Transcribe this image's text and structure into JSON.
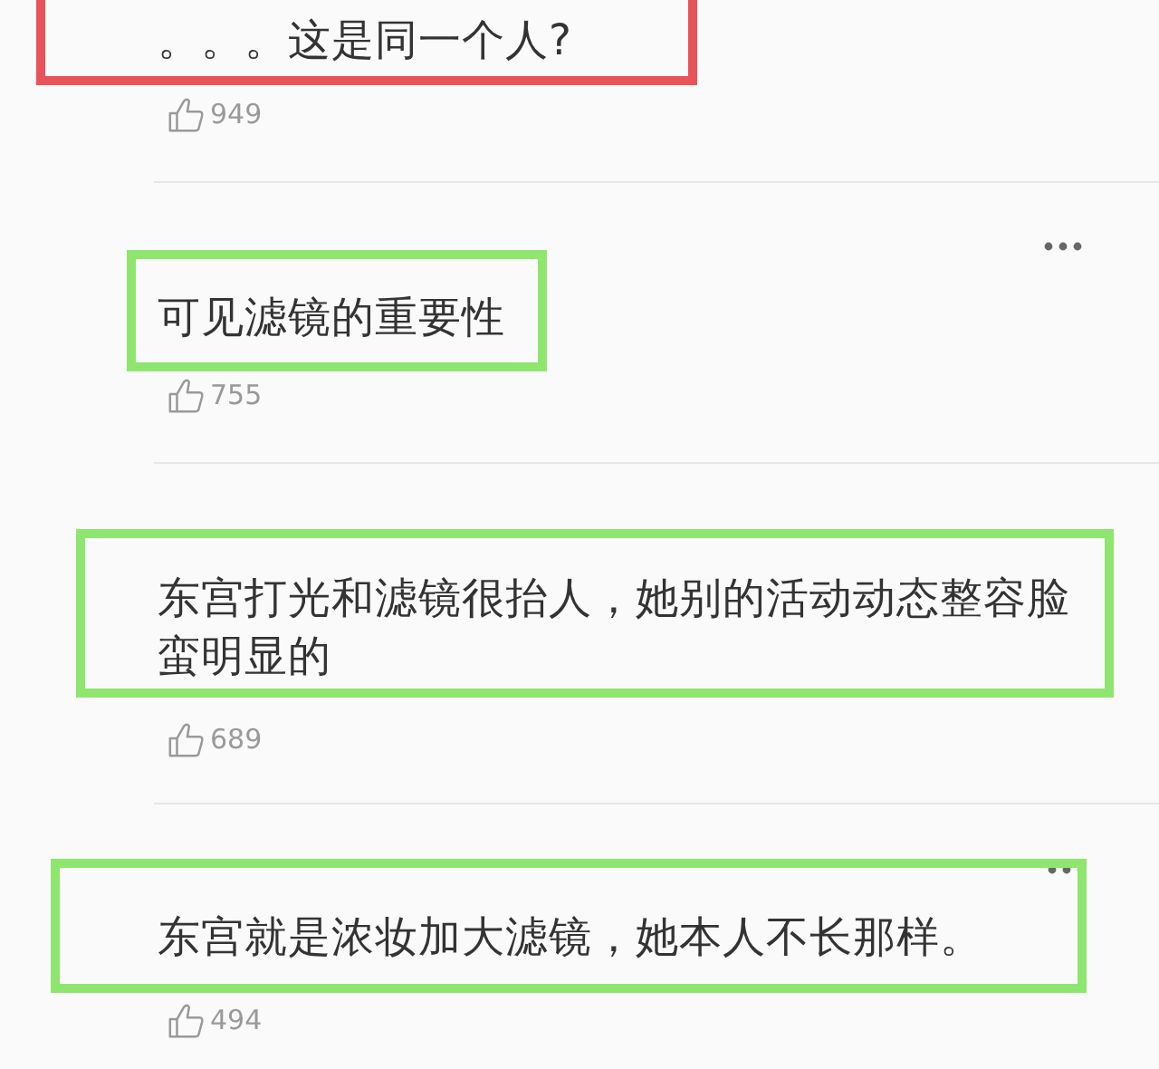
{
  "comments": [
    {
      "text": "。。。这是同一个人?",
      "likes": "949",
      "more_button": false,
      "color": "#e8545a"
    },
    {
      "text": "可见滤镜的重要性",
      "likes": "755",
      "more_button": true,
      "color": "#8ee66f"
    },
    {
      "text": "东宫打光和滤镜很抬人，她别的活动动态整容脸蛮明显的",
      "likes": "689",
      "more_button": false,
      "color": "#8ee66f"
    },
    {
      "text": "东宫就是浓妆加大滤镜，她本人不长那样。",
      "likes": "494",
      "more_button": true,
      "color": "#8ee66f"
    }
  ]
}
